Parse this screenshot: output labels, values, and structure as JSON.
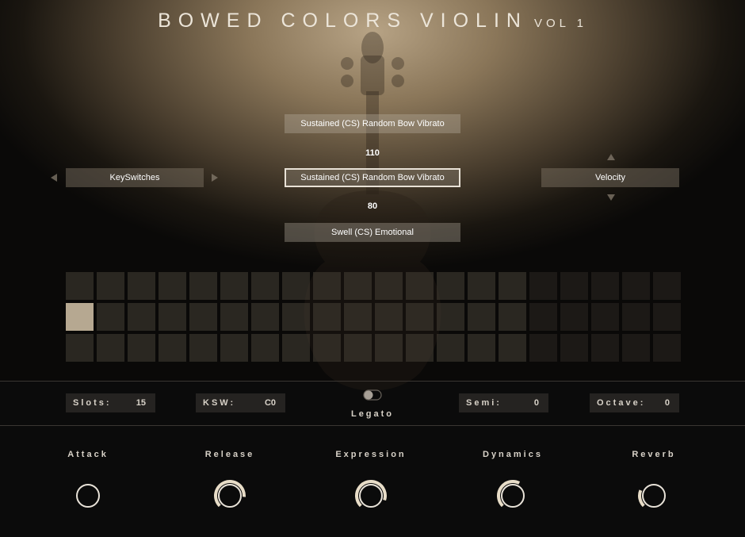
{
  "header": {
    "title": "BOWED COLORS VIOLIN",
    "volume": "VOL 1"
  },
  "articulations": {
    "previous": "Sustained (CS) Random Bow Vibrato",
    "previous_value": "110",
    "current": "Sustained (CS) Random Bow Vibrato",
    "next_value": "80",
    "next": "Swell (CS) Emotional"
  },
  "selectors": {
    "left": "KeySwitches",
    "right": "Velocity"
  },
  "slot_grid": {
    "rows": 3,
    "columns": 20,
    "active_slot": {
      "row": 1,
      "column": 0
    }
  },
  "controls": {
    "slots": {
      "label": "Slots:",
      "value": "15"
    },
    "ksw": {
      "label": "KSW:",
      "value": "C0"
    },
    "legato": {
      "label": "Legato",
      "enabled": false
    },
    "semi": {
      "label": "Semi:",
      "value": "0"
    },
    "octave": {
      "label": "Octave:",
      "value": "0"
    }
  },
  "knobs": [
    {
      "label": "Attack",
      "value": 0
    },
    {
      "label": "Release",
      "value": 0.85
    },
    {
      "label": "Expression",
      "value": 0.9
    },
    {
      "label": "Dynamics",
      "value": 0.6
    },
    {
      "label": "Reverb",
      "value": 0.25
    }
  ],
  "colors": {
    "accent": "#e8ddc8",
    "track": "#3a3632"
  }
}
